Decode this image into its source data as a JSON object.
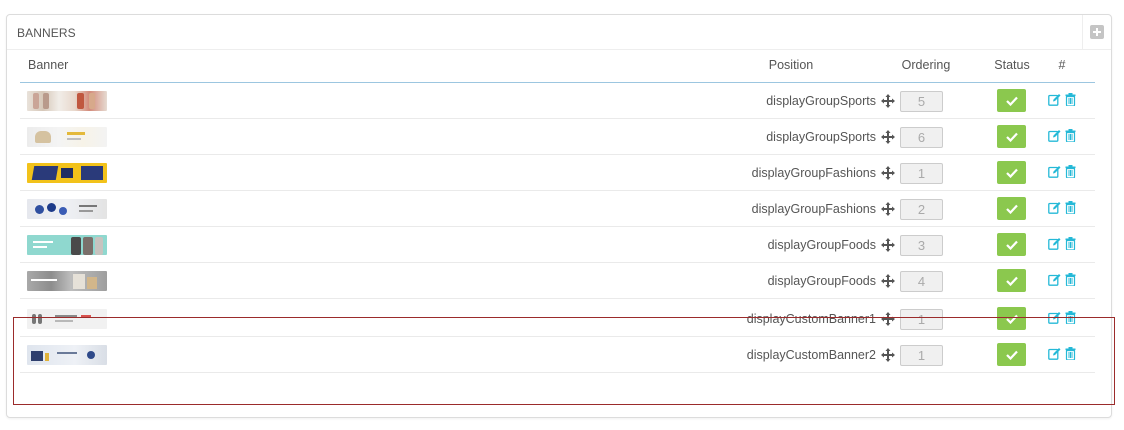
{
  "panel": {
    "title": "BANNERS"
  },
  "columns": {
    "banner": "Banner",
    "position": "Position",
    "ordering": "Ordering",
    "status": "Status",
    "actions": "#"
  },
  "rows": [
    {
      "position": "displayGroupSports",
      "ordering": "5",
      "thumb": "fashion-models"
    },
    {
      "position": "displayGroupSports",
      "ordering": "6",
      "thumb": "chair-luxury"
    },
    {
      "position": "displayGroupFashions",
      "ordering": "1",
      "thumb": "laptops-yellow"
    },
    {
      "position": "displayGroupFashions",
      "ordering": "2",
      "thumb": "watches"
    },
    {
      "position": "displayGroupFoods",
      "ordering": "3",
      "thumb": "shirts-teal"
    },
    {
      "position": "displayGroupFoods",
      "ordering": "4",
      "thumb": "bags-gray"
    },
    {
      "position": "displayCustomBanner1",
      "ordering": "1",
      "thumb": "big-sale"
    },
    {
      "position": "displayCustomBanner2",
      "ordering": "1",
      "thumb": "custom-banner-2"
    }
  ],
  "colors": {
    "status_green": "#8bc84e",
    "accent_blue": "#25b9d7",
    "highlight_red": "#9b2b2b"
  }
}
